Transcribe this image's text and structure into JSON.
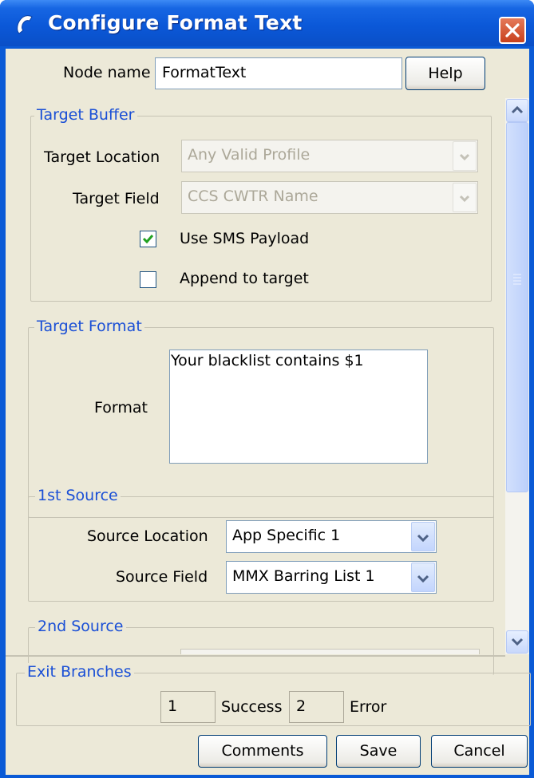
{
  "window": {
    "title": "Configure Format Text"
  },
  "node": {
    "label": "Node name",
    "value": "FormatText",
    "help_label": "Help"
  },
  "target_buffer": {
    "legend": "Target Buffer",
    "location_label": "Target Location",
    "location_value": "Any Valid Profile",
    "field_label": "Target Field",
    "field_value": "CCS CWTR Name",
    "use_sms_label": "Use SMS Payload",
    "use_sms_checked": true,
    "append_label": "Append to target",
    "append_checked": false
  },
  "target_format": {
    "legend": "Target Format",
    "format_label": "Format",
    "format_value": "Your blacklist contains $1"
  },
  "source1": {
    "legend": "1st Source",
    "location_label": "Source Location",
    "location_value": "App Specific 1",
    "field_label": "Source Field",
    "field_value": "MMX Barring List 1"
  },
  "source2": {
    "legend": "2nd Source"
  },
  "exit_branches": {
    "legend": "Exit Branches",
    "branches": [
      {
        "number": "1",
        "label": "Success"
      },
      {
        "number": "2",
        "label": "Error"
      }
    ]
  },
  "buttons": {
    "comments": "Comments",
    "save": "Save",
    "cancel": "Cancel"
  },
  "colors": {
    "titlebar": "#0a58d8",
    "panel": "#ece9d8",
    "legend": "#1a4fd6",
    "close": "#c8401c"
  }
}
